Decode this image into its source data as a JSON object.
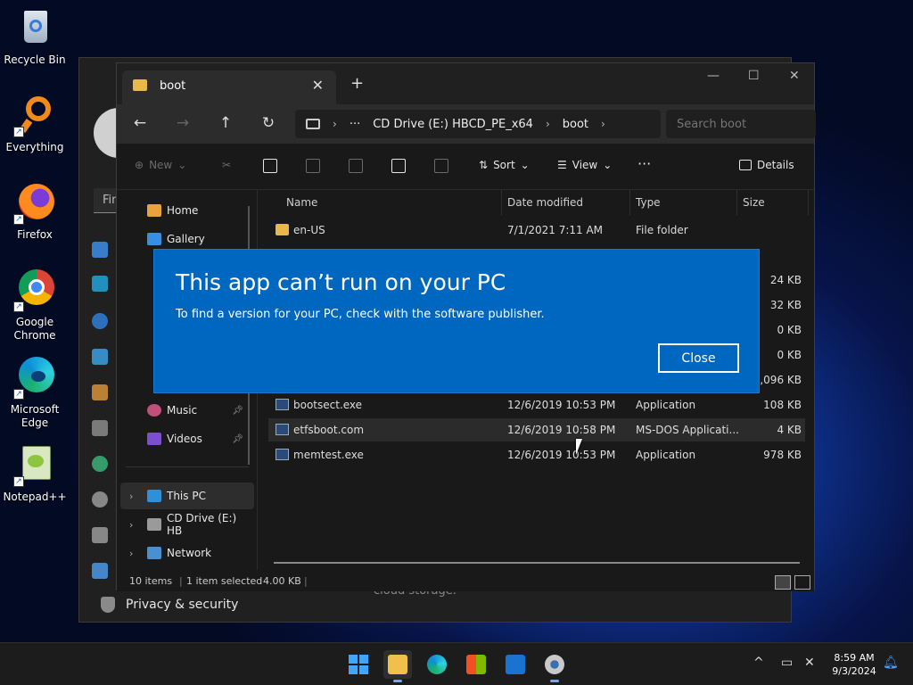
{
  "desktop": {
    "icons": [
      {
        "name": "recycle-bin",
        "label": "Recycle Bin",
        "icon": "recycle-bin-icon"
      },
      {
        "name": "everything",
        "label": "Everything",
        "icon": "magnifier-icon"
      },
      {
        "name": "firefox",
        "label": "Firefox",
        "icon": "firefox-icon"
      },
      {
        "name": "chrome",
        "label": "Google Chrome",
        "icon": "chrome-icon"
      },
      {
        "name": "edge",
        "label": "Microsoft Edge",
        "icon": "edge-icon"
      },
      {
        "name": "notepadpp",
        "label": "Notepad++",
        "icon": "notepad-icon"
      }
    ]
  },
  "background_window": {
    "search_placeholder": "Fin",
    "privacy_label": "Privacy & security",
    "footer_text": "cloud storage."
  },
  "explorer": {
    "tab_title": "boot",
    "new_tab": "+",
    "breadcrumb": {
      "more": "···",
      "drive": "CD Drive (E:) HBCD_PE_x64",
      "folder": "boot"
    },
    "search_placeholder": "Search boot",
    "toolbar": {
      "new_label": "New",
      "sort_label": "Sort",
      "view_label": "View",
      "more_label": "···",
      "details_label": "Details"
    },
    "sidebar": {
      "home": "Home",
      "gallery": "Gallery",
      "music": "Music",
      "videos": "Videos",
      "this_pc": "This PC",
      "cd_drive": "CD Drive (E:) HB",
      "network": "Network"
    },
    "columns": {
      "name": "Name",
      "date_modified": "Date modified",
      "type": "Type",
      "size": "Size"
    },
    "files": [
      {
        "name": "en-US",
        "date": "7/1/2021 7:11 AM",
        "type": "File folder",
        "size": ""
      },
      {
        "name": "",
        "date": "",
        "type": "",
        "size": "24 KB"
      },
      {
        "name": "",
        "date": "",
        "type": "",
        "size": "32 KB"
      },
      {
        "name": "",
        "date": "",
        "type": "",
        "size": "0 KB"
      },
      {
        "name": "",
        "date": "",
        "type": "",
        "size": "0 KB"
      },
      {
        "name": "",
        "date": "",
        "type": "",
        "size": "3,096 KB"
      },
      {
        "name": "bootsect.exe",
        "date": "12/6/2019 10:53 PM",
        "type": "Application",
        "size": "108 KB"
      },
      {
        "name": "etfsboot.com",
        "date": "12/6/2019 10:58 PM",
        "type": "MS-DOS Applicati...",
        "size": "4 KB"
      },
      {
        "name": "memtest.exe",
        "date": "12/6/2019 10:53 PM",
        "type": "Application",
        "size": "978 KB"
      }
    ],
    "status": {
      "items": "10 items",
      "selected": "1 item selected",
      "size": "4.00 KB"
    }
  },
  "dialog": {
    "title": "This app can’t run on your PC",
    "message": "To find a version for your PC, check with the software publisher.",
    "close_label": "Close"
  },
  "taskbar": {
    "clock_time": "8:59 AM",
    "clock_date": "9/3/2024",
    "tray_chevron": "^"
  },
  "colors": {
    "dialog_blue": "#0067c0",
    "explorer_bg": "#191919",
    "folder_yellow": "#e8b84a"
  }
}
